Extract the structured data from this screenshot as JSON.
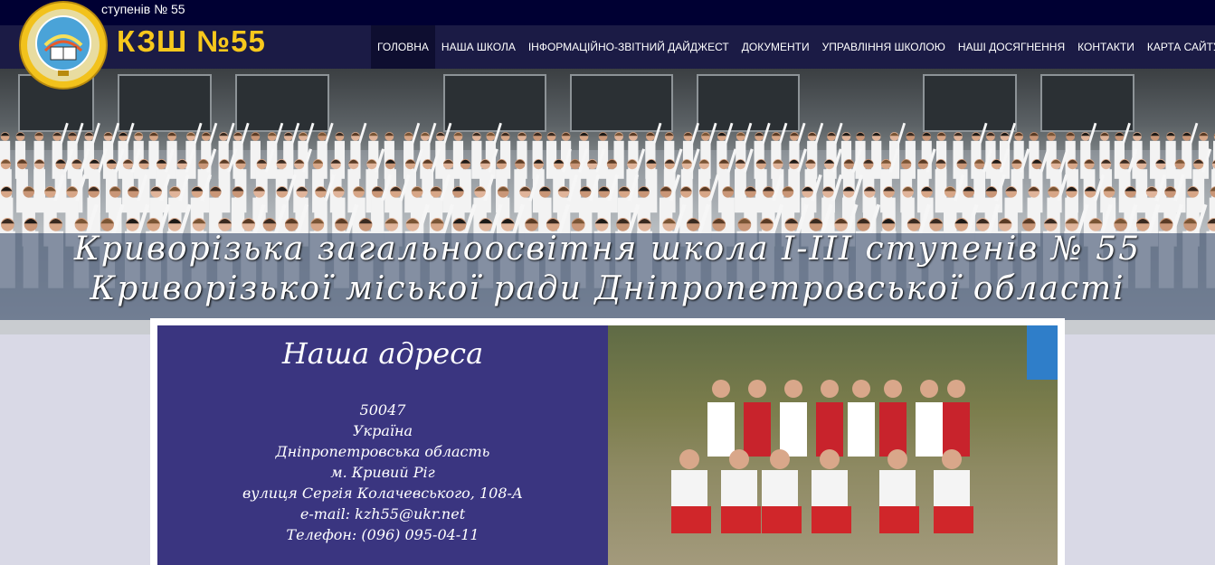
{
  "topbar": {
    "text": "ступенів № 55"
  },
  "header": {
    "brand": "КЗШ №55",
    "logo_icon": "school-globe-emblem-icon"
  },
  "nav": {
    "items": [
      {
        "label": "ГОЛОВНА",
        "active": true
      },
      {
        "label": "НАША ШКОЛА"
      },
      {
        "label": "ІНФОРМАЦІЙНО-ЗВІТНИЙ ДАЙДЖЕСТ"
      },
      {
        "label": "ДОКУМЕНТИ"
      },
      {
        "label": "УПРАВЛІННЯ ШКОЛОЮ"
      },
      {
        "label": "НАШІ ДОСЯГНЕННЯ"
      },
      {
        "label": "КОНТАКТИ"
      },
      {
        "label": "КАРТА САЙТУ"
      }
    ]
  },
  "hero": {
    "title_line1": "Криворізька загальноосвітня школа І-ІІІ ступенів № 55",
    "title_line2": "Криворізької міської ради Дніпропетровської області"
  },
  "address": {
    "heading": "Наша адреса",
    "postal_code": "50047",
    "country": "Україна",
    "region": "Дніпропетровська область",
    "city": "м. Кривий Ріг",
    "street": "вулиця Сергія Колачевського, 108-А",
    "email": "e-mail: kzh55@ukr.net",
    "phone": "Телефон: (096) 095-04-11"
  },
  "colors": {
    "topbar": "#000033",
    "navbar": "#1b1b45",
    "brand": "#f7c81c",
    "address_panel": "#3a3580"
  }
}
